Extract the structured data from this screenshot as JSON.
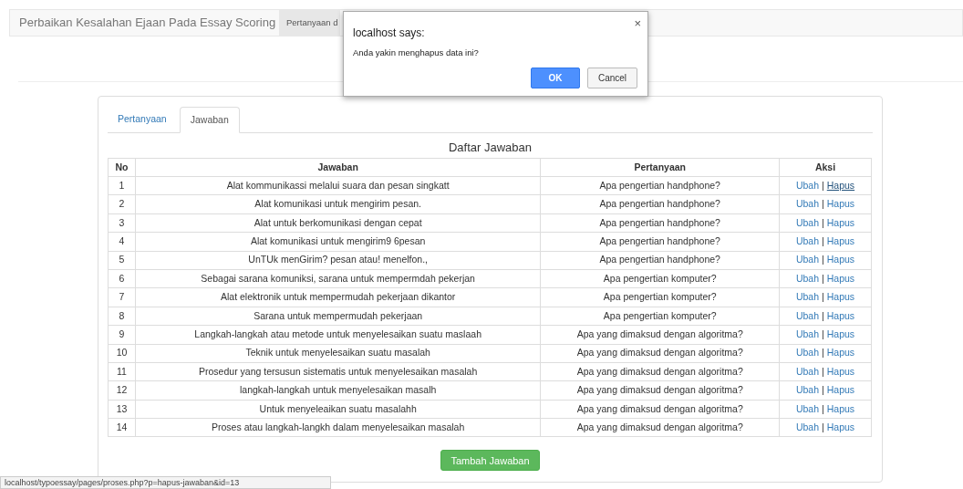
{
  "navbar": {
    "brand": "Perbaikan Kesalahan Ejaan Pada Essay Scoring",
    "items": [
      {
        "label": "Pertanyaan d",
        "selected": true
      }
    ]
  },
  "tabs": [
    {
      "label": "Pertanyaan",
      "selected": false
    },
    {
      "label": "Jawaban",
      "selected": true
    }
  ],
  "table": {
    "title": "Daftar Jawaban",
    "columns": [
      "No",
      "Jawaban",
      "Pertanyaan",
      "Aksi"
    ],
    "rows": [
      {
        "no": "1",
        "jawaban": "Alat kommunikassi melalui suara dan pesan singkatt",
        "pertanyaan": "Apa pengertian handphone?",
        "edit": "Ubah",
        "separator": "|",
        "delete": "Hapus",
        "delete_hovered": true
      },
      {
        "no": "2",
        "jawaban": "Alat komunikasi untuk mengirim pesan.",
        "pertanyaan": "Apa pengertian handphone?",
        "edit": "Ubah",
        "separator": "|",
        "delete": "Hapus",
        "delete_hovered": false
      },
      {
        "no": "3",
        "jawaban": "Alat untuk berkomunikasi dengan cepat",
        "pertanyaan": "Apa pengertian handphone?",
        "edit": "Ubah",
        "separator": "|",
        "delete": "Hapus",
        "delete_hovered": false
      },
      {
        "no": "4",
        "jawaban": "Alat komunikasi untuk mengirim9 6pesan",
        "pertanyaan": "Apa pengertian handphone?",
        "edit": "Ubah",
        "separator": "|",
        "delete": "Hapus",
        "delete_hovered": false
      },
      {
        "no": "5",
        "jawaban": "UnTUk menGirim? pesan atau! menelfon.,",
        "pertanyaan": "Apa pengertian handphone?",
        "edit": "Ubah",
        "separator": "|",
        "delete": "Hapus",
        "delete_hovered": false
      },
      {
        "no": "6",
        "jawaban": "Sebagai sarana komuniksi, sarana untuk mempermdah pekerjan",
        "pertanyaan": "Apa pengertian komputer?",
        "edit": "Ubah",
        "separator": "|",
        "delete": "Hapus",
        "delete_hovered": false
      },
      {
        "no": "7",
        "jawaban": "Alat elektronik untuk mempermudah pekerjaan dikantor",
        "pertanyaan": "Apa pengertian komputer?",
        "edit": "Ubah",
        "separator": "|",
        "delete": "Hapus",
        "delete_hovered": false
      },
      {
        "no": "8",
        "jawaban": "Sarana untuk mempermudah pekerjaan",
        "pertanyaan": "Apa pengertian komputer?",
        "edit": "Ubah",
        "separator": "|",
        "delete": "Hapus",
        "delete_hovered": false
      },
      {
        "no": "9",
        "jawaban": "Langkah-langkah atau metode untuk menyelesaikan suatu maslaah",
        "pertanyaan": "Apa yang dimaksud dengan algoritma?",
        "edit": "Ubah",
        "separator": "|",
        "delete": "Hapus",
        "delete_hovered": false
      },
      {
        "no": "10",
        "jawaban": "Teknik untuk menyelesaikan suatu masalah",
        "pertanyaan": "Apa yang dimaksud dengan algoritma?",
        "edit": "Ubah",
        "separator": "|",
        "delete": "Hapus",
        "delete_hovered": false
      },
      {
        "no": "11",
        "jawaban": "Prosedur yang tersusun sistematis untuk menyelesaikan masalah",
        "pertanyaan": "Apa yang dimaksud dengan algoritma?",
        "edit": "Ubah",
        "separator": "|",
        "delete": "Hapus",
        "delete_hovered": false
      },
      {
        "no": "12",
        "jawaban": "langkah-langkah untuk menyelesaikan masalh",
        "pertanyaan": "Apa yang dimaksud dengan algoritma?",
        "edit": "Ubah",
        "separator": "|",
        "delete": "Hapus",
        "delete_hovered": false
      },
      {
        "no": "13",
        "jawaban": "Untuk menyeleaikan suatu masalahh",
        "pertanyaan": "Apa yang dimaksud dengan algoritma?",
        "edit": "Ubah",
        "separator": "|",
        "delete": "Hapus",
        "delete_hovered": false
      },
      {
        "no": "14",
        "jawaban": "Proses atau langkah-langkh dalam menyelesaikan masalah",
        "pertanyaan": "Apa yang dimaksud dengan algoritma?",
        "edit": "Ubah",
        "separator": "|",
        "delete": "Hapus",
        "delete_hovered": false
      }
    ]
  },
  "add_button": "Tambah Jawaban",
  "status_bar": "localhost/typoessay/pages/proses.php?p=hapus-jawaban&id=13",
  "dialog": {
    "title": "localhost says:",
    "message": "Anda yakin menghapus data ini?",
    "close": "×",
    "buttons": [
      {
        "label": "OK",
        "kind": "primary"
      },
      {
        "label": "Cancel",
        "kind": "secondary"
      }
    ]
  }
}
